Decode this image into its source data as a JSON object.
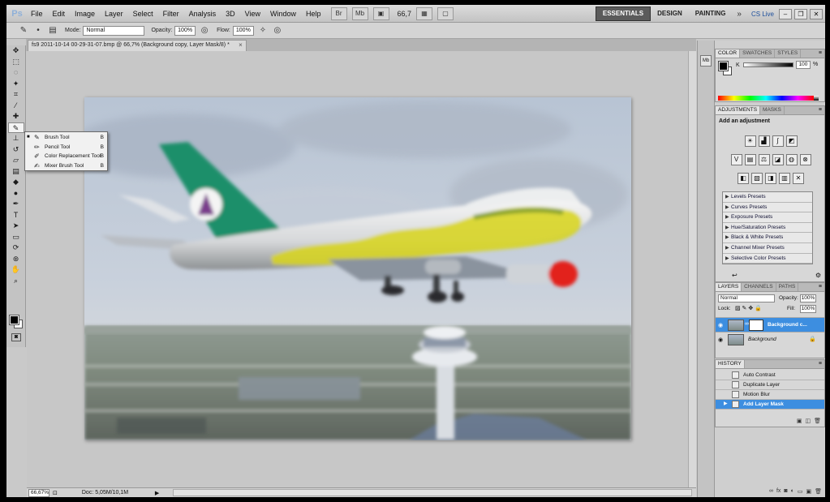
{
  "app": {
    "logo": "Ps",
    "menu": [
      "File",
      "Edit",
      "Image",
      "Layer",
      "Select",
      "Filter",
      "Analysis",
      "3D",
      "View",
      "Window",
      "Help"
    ],
    "zoom_display": "66,7",
    "workspaces": [
      "ESSENTIALS",
      "DESIGN",
      "PAINTING"
    ],
    "workspace_more": "»",
    "cs_live": "CS Live"
  },
  "options_bar": {
    "mode_label": "Mode:",
    "mode_value": "Normal",
    "opacity_label": "Opacity:",
    "opacity_value": "100%",
    "flow_label": "Flow:",
    "flow_value": "100%"
  },
  "document": {
    "tab_title": "fs9 2011-10-14 00-29-31-07.bmp @ 66,7% (Background copy, Layer Mask/8) *",
    "tab_close": "×"
  },
  "tools_flyout": [
    {
      "label": "Brush Tool",
      "key": "B",
      "selected": true
    },
    {
      "label": "Pencil Tool",
      "key": "B",
      "selected": false
    },
    {
      "label": "Color Replacement Tool",
      "key": "B",
      "selected": false
    },
    {
      "label": "Mixer Brush Tool",
      "key": "B",
      "selected": false
    }
  ],
  "status": {
    "zoom": "66,67%",
    "doc_info": "Doc: 5,05M/10,1M"
  },
  "color_panel": {
    "tabs": [
      "COLOR",
      "SWATCHES",
      "STYLES"
    ],
    "channel": "K",
    "value": "100",
    "unit": "%",
    "fg_color": "#000000",
    "bg_color": "#ffffff"
  },
  "adjustments_panel": {
    "tabs": [
      "ADJUSTMENTS",
      "MASKS"
    ],
    "title": "Add an adjustment",
    "presets": [
      "Levels Presets",
      "Curves Presets",
      "Exposure Presets",
      "Hue/Saturation Presets",
      "Black & White Presets",
      "Channel Mixer Presets",
      "Selective Color Presets"
    ]
  },
  "layers_panel": {
    "tabs": [
      "LAYERS",
      "CHANNELS",
      "PATHS"
    ],
    "blend_mode": "Normal",
    "opacity_label": "Opacity:",
    "opacity_value": "100%",
    "lock_label": "Lock:",
    "fill_label": "Fill:",
    "fill_value": "100%",
    "layers": [
      {
        "name": "Background c...",
        "selected": true
      },
      {
        "name": "Background",
        "selected": false
      }
    ]
  },
  "history_panel": {
    "tabs": [
      "HISTORY"
    ],
    "items": [
      "Auto Contrast",
      "Duplicate Layer",
      "Motion Blur",
      "Add Layer Mask"
    ],
    "selected_index": 3
  },
  "colors": {
    "selection": "#3d8ee0",
    "tail_green": "#1f8f6a",
    "engine_red": "#e2231a"
  }
}
